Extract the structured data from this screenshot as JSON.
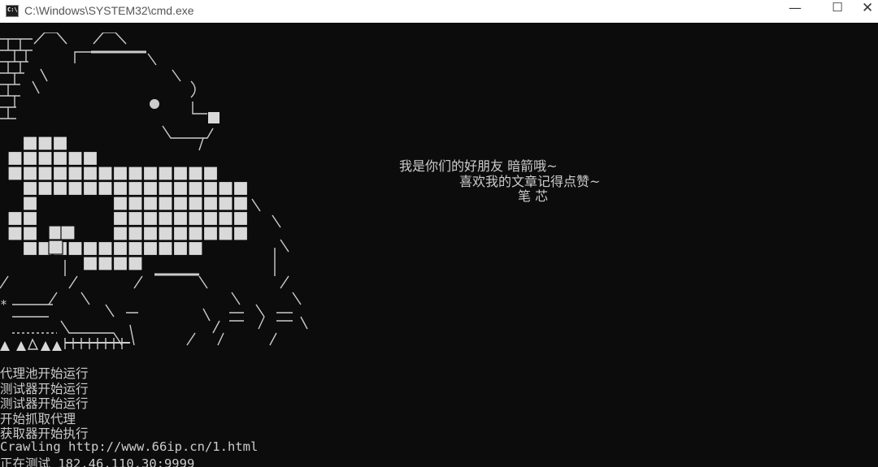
{
  "window": {
    "title": "C:\\Windows\\SYSTEM32\\cmd.exe",
    "icon": "cmd-icon",
    "icon_text": "C:\\",
    "minimize_glyph": "—",
    "maximize_glyph": "☐",
    "close_glyph": "✕"
  },
  "greeting": {
    "line1": "我是你们的好朋友 暗箭哦~",
    "line2": "喜欢我的文章记得点赞~",
    "line3": "笔 芯"
  },
  "log": [
    "代理池开始运行",
    "测试器开始运行",
    "测试器开始运行",
    "开始抓取代理",
    "获取器开始执行",
    "Crawling http://www.66ip.cn/1.html",
    "正在测试 182.46.110.30:9999"
  ],
  "colors": {
    "background": "#0c0c0c",
    "text": "#cccccc",
    "block": "#d9d9d9"
  }
}
